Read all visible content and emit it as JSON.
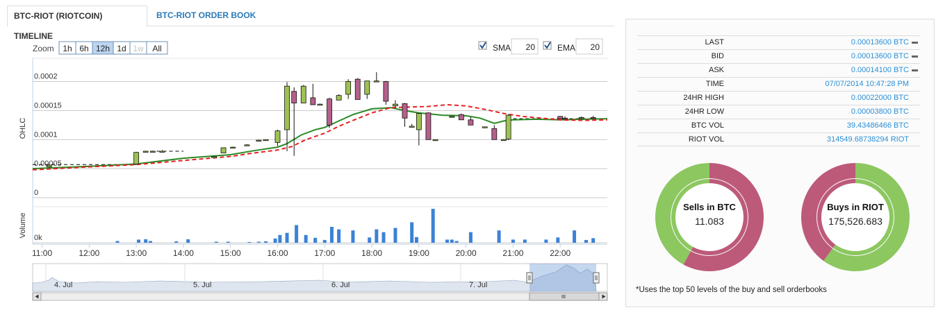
{
  "tabs": {
    "timeline": "BTC-RIOT (RIOTCOIN) TIMELINE",
    "orderbook": "BTC-RIOT ORDER BOOK"
  },
  "zoom": {
    "label": "Zoom",
    "options": [
      "1h",
      "6h",
      "12h",
      "1d",
      "1w",
      "All"
    ],
    "selected": "12h",
    "disabled": [
      "1w"
    ]
  },
  "indicators": {
    "sma_label": "SMA",
    "sma_value": "20",
    "sma_checked": true,
    "ema_label": "EMA",
    "ema_value": "20",
    "ema_checked": true
  },
  "chart_data": {
    "type": "candlestick",
    "ylabel": "OHLC",
    "volume_label": "Volume",
    "ytick_labels": [
      "0",
      "0.00005",
      "0.0001",
      "0.00015",
      "0.0002"
    ],
    "yticks": [
      0,
      5e-05,
      0.0001,
      0.00015,
      0.0002
    ],
    "ylim": [
      0,
      0.00024
    ],
    "volume_tick_label": "0k",
    "xtick_labels": [
      "11:00",
      "12:00",
      "13:00",
      "14:00",
      "15:00",
      "16:00",
      "17:00",
      "18:00",
      "19:00",
      "20:00",
      "21:00",
      "22:00"
    ],
    "xtick_hours": [
      11,
      12,
      13,
      14,
      15,
      16,
      17,
      18,
      19,
      20,
      21,
      22
    ],
    "x_range_hours": [
      10.8,
      23.0
    ],
    "candles": [
      {
        "t": 11.15,
        "o": 5.3e-05,
        "h": 5.7e-05,
        "l": 5.2e-05,
        "c": 5.6e-05
      },
      {
        "t": 13.0,
        "o": 5.8e-05,
        "h": 7.9e-05,
        "l": 5.8e-05,
        "c": 7.8e-05
      },
      {
        "t": 13.2,
        "o": 7.9e-05,
        "h": 8.1e-05,
        "l": 7.8e-05,
        "c": 8e-05
      },
      {
        "t": 13.35,
        "o": 8e-05,
        "h": 8.1e-05,
        "l": 7.9e-05,
        "c": 8e-05
      },
      {
        "t": 13.55,
        "o": 8e-05,
        "h": 8.2e-05,
        "l": 7.8e-05,
        "c": 8e-05
      },
      {
        "t": 14.65,
        "o": 6.9e-05,
        "h": 7.1e-05,
        "l": 6.9e-05,
        "c": 7.1e-05
      },
      {
        "t": 14.85,
        "o": 7.7e-05,
        "h": 8.6e-05,
        "l": 7.7e-05,
        "c": 8.6e-05
      },
      {
        "t": 15.05,
        "o": 8.7e-05,
        "h": 8.8e-05,
        "l": 8.6e-05,
        "c": 8.7e-05
      },
      {
        "t": 15.35,
        "o": 9.1e-05,
        "h": 9.2e-05,
        "l": 9e-05,
        "c": 9.1e-05
      },
      {
        "t": 15.6,
        "o": 9.9e-05,
        "h": 0.0001,
        "l": 9.8e-05,
        "c": 9.9e-05
      },
      {
        "t": 15.75,
        "o": 0.0001,
        "h": 0.0001,
        "l": 9.9e-05,
        "c": 0.0001
      },
      {
        "t": 16.0,
        "o": 9.5e-05,
        "h": 0.000117,
        "l": 8.9e-05,
        "c": 0.000115
      },
      {
        "t": 16.2,
        "o": 0.000117,
        "h": 0.000199,
        "l": 8e-05,
        "c": 0.000192
      },
      {
        "t": 16.35,
        "o": 0.000183,
        "h": 0.00019,
        "l": 7.2e-05,
        "c": 0.000163
      },
      {
        "t": 16.55,
        "o": 0.000163,
        "h": 0.000194,
        "l": 0.000163,
        "c": 0.000192
      },
      {
        "t": 16.75,
        "o": 0.000172,
        "h": 0.000196,
        "l": 0.00016,
        "c": 0.00016
      },
      {
        "t": 16.9,
        "o": 0.00016,
        "h": 0.000162,
        "l": 0.00016,
        "c": 0.000161
      },
      {
        "t": 17.1,
        "o": 0.00017,
        "h": 0.000172,
        "l": 0.00012,
        "c": 0.000125
      },
      {
        "t": 17.3,
        "o": 0.000168,
        "h": 0.000178,
        "l": 0.000168,
        "c": 0.000176
      },
      {
        "t": 17.5,
        "o": 0.000178,
        "h": 0.000204,
        "l": 0.00017,
        "c": 0.0002
      },
      {
        "t": 17.7,
        "o": 0.000204,
        "h": 0.000206,
        "l": 0.000169,
        "c": 0.000169
      },
      {
        "t": 17.9,
        "o": 0.000178,
        "h": 0.000201,
        "l": 0.00017,
        "c": 0.000201
      },
      {
        "t": 18.1,
        "o": 0.000201,
        "h": 0.000216,
        "l": 0.0002,
        "c": 0.000201
      },
      {
        "t": 18.3,
        "o": 0.0002,
        "h": 0.000201,
        "l": 0.00016,
        "c": 0.000166
      },
      {
        "t": 18.5,
        "o": 0.000158,
        "h": 0.000168,
        "l": 0.000155,
        "c": 0.000161
      },
      {
        "t": 18.7,
        "o": 0.000162,
        "h": 0.000163,
        "l": 0.000122,
        "c": 0.000137
      },
      {
        "t": 18.85,
        "o": 0.000123,
        "h": 0.000127,
        "l": 0.000122,
        "c": 0.000123
      },
      {
        "t": 19.0,
        "o": 0.000117,
        "h": 0.000146,
        "l": 9e-05,
        "c": 0.000145
      },
      {
        "t": 19.2,
        "o": 0.000146,
        "h": 0.000147,
        "l": 0.0001,
        "c": 0.0001
      },
      {
        "t": 19.35,
        "o": 0.0001,
        "h": 0.0001,
        "l": 9.9e-05,
        "c": 0.0001
      },
      {
        "t": 19.7,
        "o": 0.00014,
        "h": 0.000141,
        "l": 0.000139,
        "c": 0.00014
      },
      {
        "t": 19.9,
        "o": 0.000143,
        "h": 0.000145,
        "l": 0.000134,
        "c": 0.000134
      },
      {
        "t": 20.1,
        "o": 0.000134,
        "h": 0.000139,
        "l": 0.000125,
        "c": 0.000125
      },
      {
        "t": 20.4,
        "o": 0.000122,
        "h": 0.000122,
        "l": 0.000122,
        "c": 0.000122
      },
      {
        "t": 20.6,
        "o": 0.000119,
        "h": 0.000125,
        "l": 0.0001,
        "c": 0.0001
      },
      {
        "t": 20.8,
        "o": 0.0001,
        "h": 0.000101,
        "l": 0.0001,
        "c": 0.0001
      },
      {
        "t": 20.9,
        "o": 0.000101,
        "h": 0.000144,
        "l": 9.9e-05,
        "c": 0.000142
      },
      {
        "t": 22.0,
        "o": 0.00014,
        "h": 0.00014,
        "l": 0.000136,
        "c": 0.000136
      },
      {
        "t": 22.1,
        "o": 0.000137,
        "h": 0.00014,
        "l": 0.000135,
        "c": 0.000136
      },
      {
        "t": 22.45,
        "o": 0.000137,
        "h": 0.00014,
        "l": 0.000135,
        "c": 0.000138
      },
      {
        "t": 22.7,
        "o": 0.000138,
        "h": 0.000141,
        "l": 0.000136,
        "c": 0.000137
      }
    ],
    "sma": [
      [
        10.8,
        5e-05
      ],
      [
        12.0,
        5.4e-05
      ],
      [
        13.0,
        5.8e-05
      ],
      [
        14.0,
        6.8e-05
      ],
      [
        15.0,
        7.4e-05
      ],
      [
        15.5,
        8.1e-05
      ],
      [
        16.0,
        8.7e-05
      ],
      [
        16.2,
        9.3e-05
      ],
      [
        16.5,
        0.000108
      ],
      [
        16.8,
        0.000117
      ],
      [
        17.0,
        0.000121
      ],
      [
        17.3,
        0.000132
      ],
      [
        17.6,
        0.000143
      ],
      [
        18.0,
        0.000153
      ],
      [
        18.4,
        0.000155
      ],
      [
        18.7,
        0.00015
      ],
      [
        19.0,
        0.000146
      ],
      [
        19.5,
        0.000142
      ],
      [
        20.0,
        0.000141
      ],
      [
        20.3,
        0.000137
      ],
      [
        20.6,
        0.000128
      ],
      [
        20.8,
        0.000132
      ],
      [
        21.0,
        0.000134
      ],
      [
        21.5,
        0.000135
      ],
      [
        22.0,
        0.000134
      ],
      [
        22.5,
        0.000135
      ],
      [
        23.0,
        0.000136
      ]
    ],
    "ema": [
      [
        10.8,
        4.8e-05
      ],
      [
        12.0,
        5.3e-05
      ],
      [
        13.0,
        5.7e-05
      ],
      [
        14.0,
        6.4e-05
      ],
      [
        15.0,
        7.1e-05
      ],
      [
        15.5,
        7.7e-05
      ],
      [
        16.0,
        8.2e-05
      ],
      [
        16.3,
        8.8e-05
      ],
      [
        16.6,
        0.0001
      ],
      [
        17.0,
        0.000111
      ],
      [
        17.3,
        0.000123
      ],
      [
        17.6,
        0.000133
      ],
      [
        18.0,
        0.000146
      ],
      [
        18.4,
        0.000155
      ],
      [
        18.8,
        0.000156
      ],
      [
        19.2,
        0.000157
      ],
      [
        19.6,
        0.00016
      ],
      [
        20.0,
        0.000158
      ],
      [
        20.4,
        0.000152
      ],
      [
        20.8,
        0.000145
      ],
      [
        21.2,
        0.00014
      ],
      [
        21.6,
        0.000137
      ],
      [
        22.0,
        0.000134
      ],
      [
        22.5,
        0.000133
      ],
      [
        23.0,
        0.000134
      ]
    ],
    "last_price": 0.000136,
    "volume": [
      [
        12.6,
        5
      ],
      [
        13.05,
        9
      ],
      [
        13.2,
        10
      ],
      [
        13.3,
        5
      ],
      [
        13.85,
        4
      ],
      [
        14.1,
        10
      ],
      [
        14.7,
        3
      ],
      [
        14.95,
        3
      ],
      [
        15.4,
        2
      ],
      [
        15.6,
        3
      ],
      [
        15.75,
        4
      ],
      [
        15.95,
        12
      ],
      [
        16.05,
        22
      ],
      [
        16.2,
        28
      ],
      [
        16.4,
        50
      ],
      [
        16.6,
        22
      ],
      [
        16.8,
        14
      ],
      [
        17.0,
        8
      ],
      [
        17.15,
        45
      ],
      [
        17.3,
        38
      ],
      [
        17.6,
        35
      ],
      [
        17.95,
        15
      ],
      [
        18.1,
        38
      ],
      [
        18.25,
        30
      ],
      [
        18.5,
        42
      ],
      [
        18.85,
        58
      ],
      [
        18.95,
        16
      ],
      [
        19.3,
        96
      ],
      [
        19.6,
        9
      ],
      [
        19.7,
        9
      ],
      [
        19.8,
        5
      ],
      [
        20.1,
        30
      ],
      [
        20.7,
        35
      ],
      [
        21.0,
        9
      ],
      [
        21.25,
        9
      ],
      [
        21.7,
        9
      ],
      [
        21.95,
        15
      ],
      [
        22.3,
        35
      ],
      [
        22.55,
        8
      ],
      [
        22.7,
        13
      ]
    ],
    "volume_max": 100,
    "navigator": {
      "date_labels": [
        "4. Jul",
        "5. Jul",
        "6. Jul",
        "7. Jul"
      ]
    }
  },
  "stats": [
    {
      "label": "LAST",
      "value": "0.00013600 BTC",
      "dash": true
    },
    {
      "label": "BID",
      "value": "0.00013600 BTC",
      "dash": true
    },
    {
      "label": "ASK",
      "value": "0.00014100 BTC",
      "dash": true
    },
    {
      "label": "TIME",
      "value": "07/07/2014 10:47:28 PM",
      "dash": false
    },
    {
      "label": "24HR HIGH",
      "value": "0.00022000 BTC",
      "dash": false
    },
    {
      "label": "24HR LOW",
      "value": "0.00003800 BTC",
      "dash": false
    },
    {
      "label": "BTC VOL",
      "value": "39.43486466 BTC",
      "dash": false
    },
    {
      "label": "RIOT VOL",
      "value": "314549.68738294 RIOT",
      "dash": false
    }
  ],
  "donuts": [
    {
      "title": "Sells in BTC",
      "value": "11.083",
      "share": 0.58,
      "primary": "#bd5a7a",
      "secondary": "#8cc760"
    },
    {
      "title": "Buys in RIOT",
      "value": "175,526.683",
      "share": 0.6,
      "primary": "#8cc760",
      "secondary": "#bd5a7a"
    }
  ],
  "footnote": "*Uses the top 50 levels of the buy and sell orderbooks",
  "colors": {
    "up": "#9dc253",
    "down": "#b5608a",
    "sma": "#2a8a25",
    "ema": "#e52020",
    "volume": "#3c82d6",
    "link": "#2a8fd6"
  }
}
